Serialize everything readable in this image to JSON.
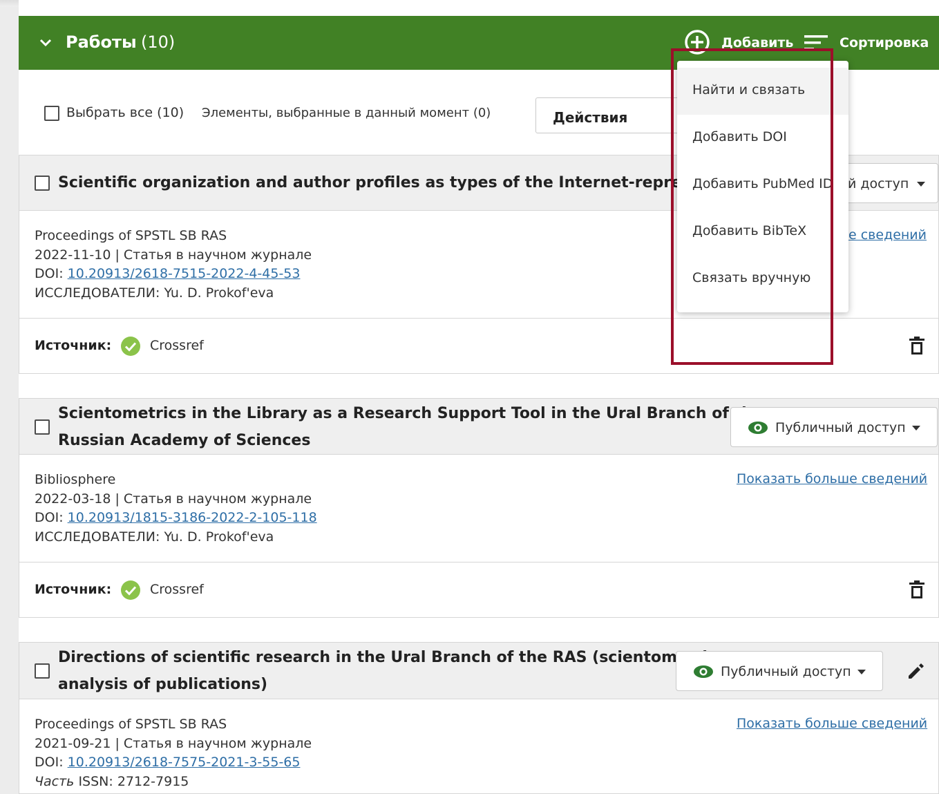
{
  "header": {
    "title": "Работы",
    "count": "(10)",
    "add_label": "Добавить",
    "sort_label": "Сортировка",
    "color": "#418125"
  },
  "toolbar": {
    "select_all": "Выбрать все (10)",
    "selected": "Элементы, выбранные в данный момент (0)",
    "actions": "Действия"
  },
  "add_menu": {
    "items": [
      {
        "label": "Найти и связать"
      },
      {
        "label": "Добавить DOI"
      },
      {
        "label": "Добавить PubMed ID"
      },
      {
        "label": "Добавить BibTeX"
      },
      {
        "label": "Связать вручную"
      }
    ],
    "highlight_color": "#9b0f2a"
  },
  "labels": {
    "visibility": "Публичный доступ",
    "visibility_partial": "й доступ",
    "show_more": "Показать больше сведений",
    "show_more_partial": "е сведений",
    "source": "Источник:",
    "doi_prefix": "DOI:",
    "researchers_prefix": "ИССЛЕДОВАТЕЛИ:"
  },
  "works": [
    {
      "title": "Scientific organization and author profiles as types of the Internet-representati",
      "journal": "Proceedings of SPSTL SB RAS",
      "date_type": "2022-11-10 | Статья в научном журнале",
      "doi": "10.20913/2618-7515-2022-4-45-53",
      "researchers": "Yu. D. Prokof'eva",
      "source": "Crossref"
    },
    {
      "title_line1": "Scientometrics in the Library as a Research Support Tool in the Ural Branch of the",
      "title_line2": "Russian Academy of Sciences",
      "journal": "Bibliosphere",
      "date_type": "2022-03-18 | Статья в научном журнале",
      "doi": "10.20913/1815-3186-2022-2-105-118",
      "researchers": "Yu. D. Prokof'eva",
      "source": "Crossref"
    },
    {
      "title_line1": "Directions of scientific research in the Ural Branch of the RAS (scientometric",
      "title_line2": "analysis of publications)",
      "journal": "Proceedings of SPSTL SB RAS",
      "date_type": "2021-09-21 | Статья в научном журнале",
      "doi": "10.20913/2618-7575-2021-3-55-65",
      "part_label": "Часть",
      "issn": "ISSN: 2712-7915"
    }
  ]
}
